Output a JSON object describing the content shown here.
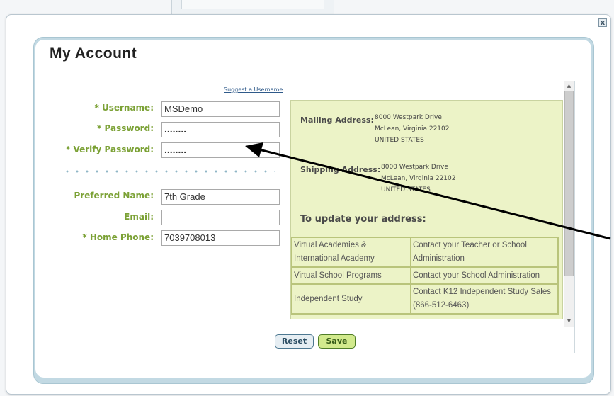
{
  "dialog": {
    "title": "My Account",
    "close_label": "x"
  },
  "form": {
    "suggest_link": "Suggest a Username",
    "fields": [
      {
        "label": "* Username:",
        "value": "MSDemo"
      },
      {
        "label": "* Password:",
        "value": "........"
      },
      {
        "label": "* Verify Password:",
        "value": "........"
      },
      {
        "label": "Preferred Name:",
        "value": "7th Grade"
      },
      {
        "label": "Email:",
        "value": ""
      },
      {
        "label": "* Home Phone:",
        "value": "7039708013"
      }
    ]
  },
  "address": {
    "mailing_label": "Mailing Address:",
    "mailing_lines": [
      "8000 Westpark Drive",
      "McLean, Virginia 22102",
      "UNITED STATES"
    ],
    "shipping_label": "Shipping Address:",
    "shipping_lines": [
      "8000 Westpark Drive",
      "McLean, Virginia 22102",
      "UNITED STATES"
    ],
    "update_heading": "To update your address:",
    "contacts": [
      {
        "program": "Virtual Academies & International Academy",
        "contact": "Contact your Teacher or School Administration"
      },
      {
        "program": "Virtual School Programs",
        "contact": "Contact your School Administration"
      },
      {
        "program": "Independent Study",
        "contact": "Contact K12 Independent Study Sales (866-512-6463)"
      }
    ]
  },
  "buttons": {
    "reset": "Reset",
    "save": "Save"
  },
  "colors": {
    "label_green": "#7ba135",
    "address_bg": "#ecf3c7",
    "panel_blue": "#c2d9e3"
  }
}
